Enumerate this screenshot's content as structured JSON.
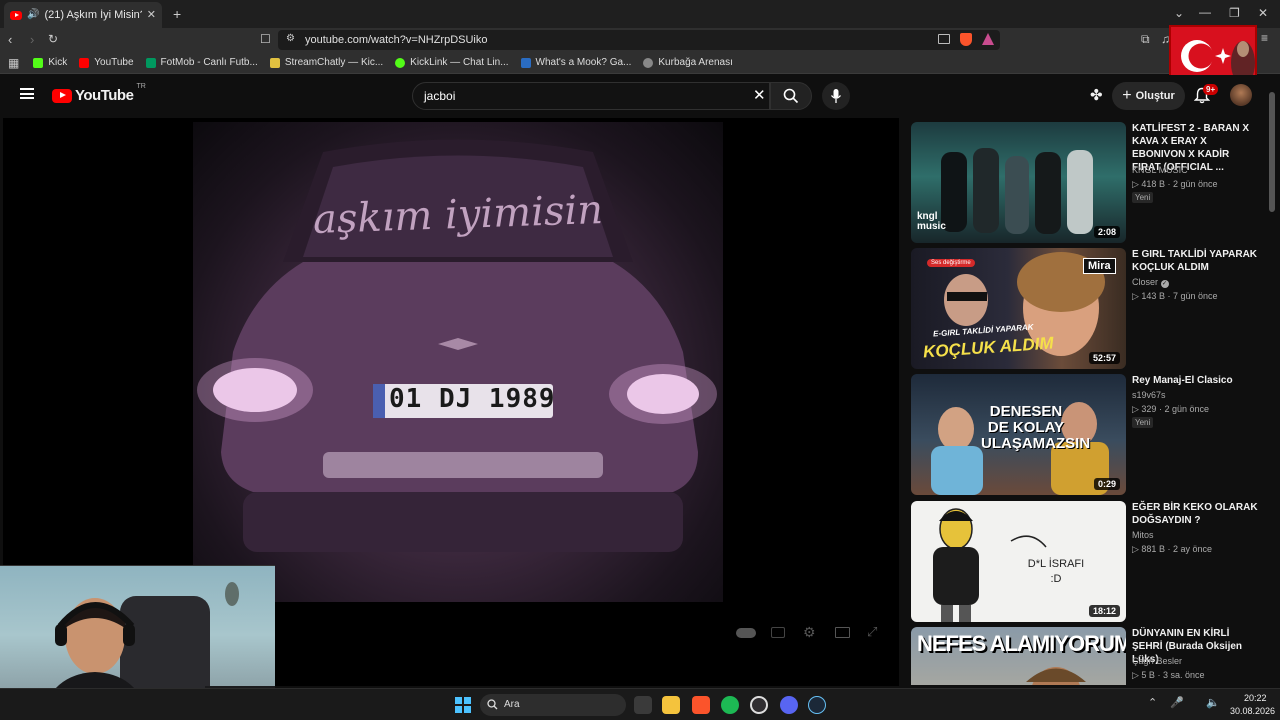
{
  "browser": {
    "tab_title": "(21) Aşkım İyi Misin? - YouTube",
    "new_tab_symbol": "+",
    "url": "youtube.com/watch?v=NHZrpDSUiko",
    "bookmarks": [
      {
        "label": "Kick",
        "color": "#53fc18"
      },
      {
        "label": "YouTube",
        "color": "#ff0000"
      },
      {
        "label": "FotMob - Canlı Futb...",
        "color": "#00985f"
      },
      {
        "label": "StreamChatly — Kic...",
        "color": "#e0c040"
      },
      {
        "label": "KickLink — Chat Lin...",
        "color": "#53fc18"
      },
      {
        "label": "What's a Mook? Ga...",
        "color": "#2a6cc2"
      },
      {
        "label": "Kurbağa Arenası",
        "color": "#888888"
      }
    ]
  },
  "youtube": {
    "logo_text": "YouTube",
    "region": "TR",
    "search_value": "jacboi",
    "create_label": "Oluştur",
    "notification_count": "9+"
  },
  "video": {
    "plate_text": "01 DJ 1989",
    "window_text": "aşkım iyimisin"
  },
  "recommendations": [
    {
      "title": "KATLİFEST 2 - BARAN X KAVA X ERAY X EBONIVON X KADİR FIRAT (OFFICIAL ...",
      "channel": "KNGL MUSIC",
      "views": "418 B",
      "age": "2 gün önce",
      "badge": "Yeni",
      "duration": "2:08",
      "thumb_text": "kngl music",
      "verified": false
    },
    {
      "title": "E GIRL TAKLİDİ YAPARAK KOÇLUK ALDIM",
      "channel": "Closer",
      "views": "143 B",
      "age": "7 gün önce",
      "badge": "",
      "duration": "52:57",
      "thumb_text": "KOÇLUK ALDIM",
      "thumb_sub": "E-GIRL TAKLİDİ YAPARAK",
      "thumb_tag": "Mira",
      "verified": true
    },
    {
      "title": "Rey Manaj-El Clasico",
      "channel": "s19v67s",
      "views": "329",
      "age": "2 gün önce",
      "badge": "Yeni",
      "duration": "0:29",
      "thumb_text": "DENESEN DE KOLAY ULAŞAMAZSIN",
      "verified": false
    },
    {
      "title": "EĞER BİR KEKO OLARAK DOĞSAYDIN ?",
      "channel": "Mitos",
      "views": "881 B",
      "age": "2 ay önce",
      "badge": "",
      "duration": "18:12",
      "thumb_text": "D*L İSRAFI :D",
      "verified": false
    },
    {
      "title": "DÜNYANIN EN KİRLİ ŞEHRİ (Burada Oksijen Lüks)",
      "channel": "Çağrı Besler",
      "views": "5 B",
      "age": "3 sa. önce",
      "badge": "",
      "duration": "",
      "thumb_text": "NEFES ALAMIYORUM",
      "verified": false
    }
  ],
  "taskbar": {
    "search_label": "Ara",
    "time": "20:22",
    "date": "30.08.2026"
  },
  "colors": {
    "youtube_red": "#ff0000",
    "background": "#0f0f0f",
    "video_tint": "#6a4a6a"
  }
}
